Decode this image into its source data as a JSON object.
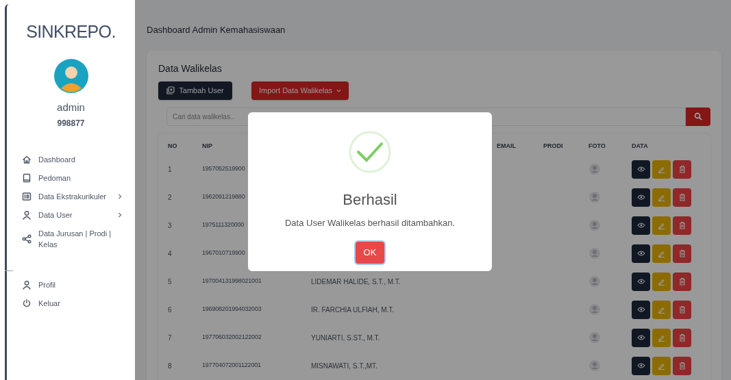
{
  "sidebar": {
    "logo": "SINKREPO.",
    "user": {
      "name": "admin",
      "id": "998877"
    },
    "menu": [
      {
        "label": "Dashboard",
        "has_submenu": false
      },
      {
        "label": "Pedoman",
        "has_submenu": false
      },
      {
        "label": "Data Ekstrakurikuler",
        "has_submenu": true
      },
      {
        "label": "Data User",
        "has_submenu": true
      },
      {
        "label": "Data Jurusan | Prodi | Kelas",
        "has_submenu": false
      }
    ],
    "footer_menu": [
      {
        "label": "Profil",
        "has_submenu": false
      },
      {
        "label": "Keluar",
        "has_submenu": false
      }
    ]
  },
  "header": {
    "title": "Dashboard Admin Kemahasiswaan"
  },
  "card": {
    "title": "Data Walikelas",
    "buttons": [
      {
        "label": "Tambah User",
        "kind": "add"
      },
      {
        "label": "Import Data Walikelas",
        "kind": "dropdown"
      }
    ],
    "search": {
      "placeholder": "Cari data walikelas.."
    },
    "table": {
      "columns": [
        "NO",
        "NIP",
        "EMAIL",
        "PRODI",
        "FOTO",
        "DATA"
      ],
      "rows": [
        {
          "no": "1",
          "nip": "1957052519900"
        },
        {
          "no": "2",
          "nip": "1962091219880"
        },
        {
          "no": "3",
          "nip": "1975111320000"
        },
        {
          "no": "4",
          "nip": "1967010719900"
        },
        {
          "no": "5",
          "nip": "197004131998021001",
          "name": "LIDEMAR HALIDE, S.T., M.T."
        },
        {
          "no": "6",
          "nip": "196908201994032003",
          "name": "IR. FARCHIA ULFIAH, M.T."
        },
        {
          "no": "7",
          "nip": "197706032002122002",
          "name": "YUNIARTI, S.ST., M.T."
        },
        {
          "no": "8",
          "nip": "197704072001122001",
          "name": "MISNAWATI, S.T.,MT."
        }
      ]
    }
  },
  "dialog": {
    "title": "Berhasil",
    "message": "Data User Walikelas berhasil ditambahkan.",
    "button": "OK"
  }
}
